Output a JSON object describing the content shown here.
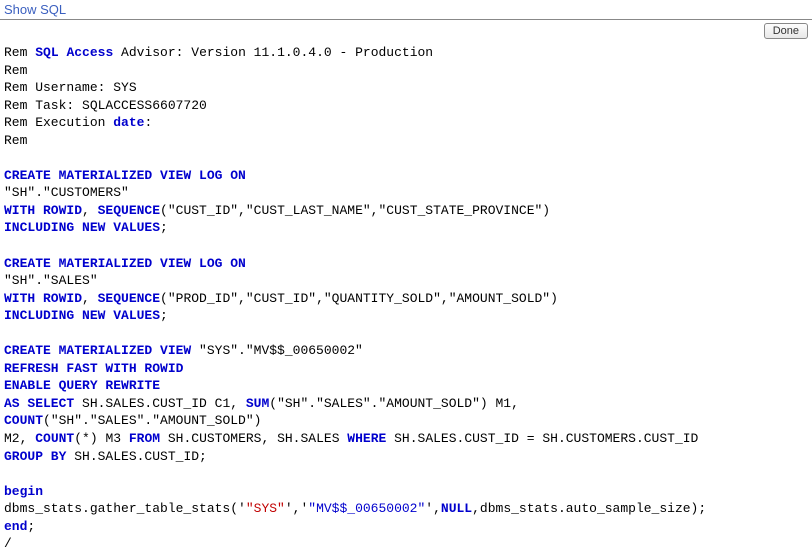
{
  "title": "Show SQL",
  "done_label": "Done",
  "rem_prefix": "Rem ",
  "rem_sql": "SQL",
  "rem_access": "Access",
  "rem_advisor": " Advisor: Version 11.1.0.4.0 - Production",
  "rem_only": "Rem ",
  "rem_username": "Rem Username: SYS",
  "rem_task": "Rem Task: SQLACCESS6607720",
  "rem_exec_pre": "Rem Execution ",
  "rem_date": "date",
  "rem_exec_post": ":",
  "rem_trail": "Rem",
  "mvlog_create": "CREATE MATERIALIZED VIEW LOG ON",
  "log1_table": "\"SH\".\"CUSTOMERS\"",
  "with_rowid": "WITH ROWID",
  "comma_space": ", ",
  "sequence_kw": "SEQUENCE",
  "log1_cols": "(\"CUST_ID\",\"CUST_LAST_NAME\",\"CUST_STATE_PROVINCE\")",
  "including_new": "INCLUDING NEW VALUES",
  "semicolon": ";",
  "log2_table": "\"SH\".\"SALES\"",
  "log2_cols": "(\"PROD_ID\",\"CUST_ID\",\"QUANTITY_SOLD\",\"AMOUNT_SOLD\")",
  "mv_create": "CREATE MATERIALIZED VIEW",
  "mv_name": " \"SYS\".\"MV$$_00650002\"",
  "refresh": "REFRESH FAST WITH ROWID",
  "enable_qr": "ENABLE QUERY REWRITE",
  "as_select": "AS SELECT",
  "sel_part1": " SH.SALES.CUST_ID C1, ",
  "sum_kw": "SUM",
  "sum_arg": "(\"SH\".\"SALES\".\"AMOUNT_SOLD\") M1,",
  "count_kw": "COUNT",
  "count_arg": "(\"SH\".\"SALES\".\"AMOUNT_SOLD\")",
  "m2_clause": "M2, ",
  "count_star": "(*) M3 ",
  "from_kw": "FROM",
  "from_tables": " SH.CUSTOMERS, SH.SALES ",
  "where_kw": "WHERE",
  "where_cond": " SH.SALES.CUST_ID = SH.CUSTOMERS.CUST_ID",
  "group_by_kw": "GROUP BY",
  "group_by_col": " SH.SALES.CUST_ID;",
  "begin_kw": "begin",
  "gather_call": "dbms_stats.gather_table_stats('",
  "sys_lit": "\"SYS\"",
  "q_comma_q": "','",
  "mv_lit": "\"MV$$_00650002\"",
  "gather_tail": "',",
  "null_kw": "NULL",
  "gather_end": ",dbms_stats.auto_sample_size);",
  "end_kw": "end",
  "slash": "/"
}
